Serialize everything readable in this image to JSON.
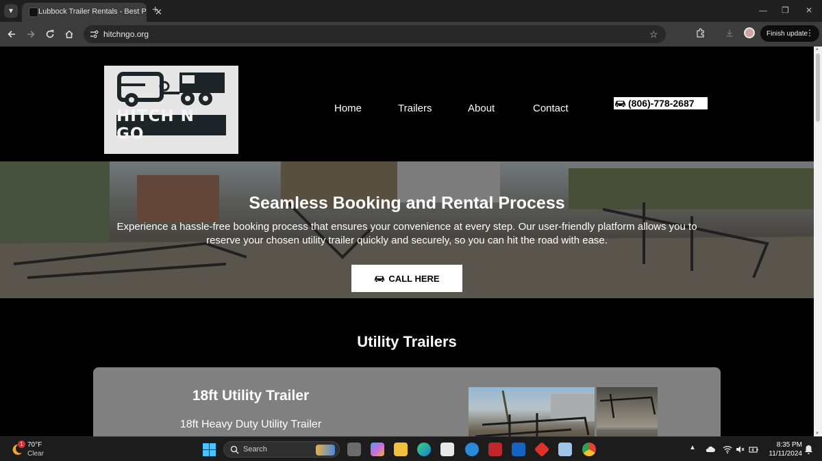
{
  "browser": {
    "tab_title": "Lubbock Trailer Rentals - Best P",
    "url": "hitchngo.org",
    "finish_update_label": "Finish update",
    "tab_close": "✕",
    "new_tab": "+",
    "window_controls": [
      "—",
      "❐",
      "✕"
    ],
    "bookmark_glyph": "☆",
    "menu_glyph": "⋮"
  },
  "site": {
    "logo_text": "HITCH N GO",
    "nav": [
      "Home",
      "Trailers",
      "About",
      "Contact"
    ],
    "phone": "(806)-778-2687",
    "hero": {
      "title": "Seamless Booking and Rental Process",
      "text": "Experience a hassle-free booking process that ensures your convenience at every step. Our user-friendly platform allows you to reserve your chosen utility trailer quickly and securely, so you can hit the road with ease.",
      "cta": "CALL HERE"
    },
    "section_title": "Utility Trailers",
    "card": {
      "title": "18ft Utility Trailer",
      "subtitle": "18ft Heavy Duty Utility Trailer"
    }
  },
  "taskbar": {
    "weather_badge": "1",
    "weather_temp": "70°F",
    "weather_condition": "Clear",
    "search_placeholder": "Search",
    "time": "8:35 PM",
    "date": "11/11/2024"
  },
  "colors": {
    "chrome_dark": "#1f1f1f",
    "toolbar": "#3c3c3c",
    "page_bg": "#000000",
    "card_bg": "#808080",
    "button_bg": "#ffffff"
  }
}
